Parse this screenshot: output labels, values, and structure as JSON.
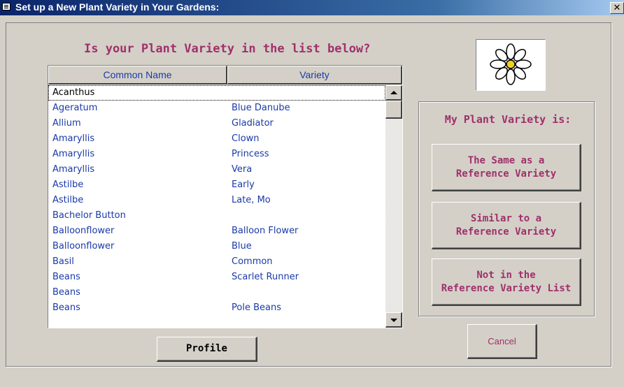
{
  "window": {
    "title": "Set up a New Plant Variety in Your Gardens:",
    "close_glyph": "✕"
  },
  "heading": "Is your Plant Variety in the list below?",
  "list": {
    "columns": [
      "Common Name",
      "Variety"
    ],
    "selected_index": 0,
    "rows": [
      {
        "name": "Acanthus",
        "variety": ""
      },
      {
        "name": "Ageratum",
        "variety": "Blue Danube"
      },
      {
        "name": "Allium",
        "variety": "Gladiator"
      },
      {
        "name": "Amaryllis",
        "variety": "Clown"
      },
      {
        "name": "Amaryllis",
        "variety": "Princess"
      },
      {
        "name": "Amaryllis",
        "variety": "Vera"
      },
      {
        "name": "Astilbe",
        "variety": "Early"
      },
      {
        "name": "Astilbe",
        "variety": "Late, Mo"
      },
      {
        "name": "Bachelor Button",
        "variety": ""
      },
      {
        "name": "Balloonflower",
        "variety": "Balloon Flower"
      },
      {
        "name": "Balloonflower",
        "variety": "Blue"
      },
      {
        "name": "Basil",
        "variety": "Common"
      },
      {
        "name": "Beans",
        "variety": "Scarlet Runner"
      },
      {
        "name": "Beans",
        "variety": ""
      },
      {
        "name": "Beans",
        "variety": "Pole Beans"
      }
    ]
  },
  "buttons": {
    "profile": "Profile",
    "cancel": "Cancel"
  },
  "panel": {
    "label": "My Plant Variety is:",
    "options": [
      "The Same as a\nReference Variety",
      "Similar to a\nReference Variety",
      "Not in the\nReference Variety List"
    ]
  },
  "icons": {
    "window_icon": "form-icon",
    "flower_image": "daisy-flower-icon"
  },
  "colors": {
    "title_bar": "#0a246a",
    "accent_text": "#a0306a",
    "list_text": "#1a3aa8",
    "face": "#d4d0c8"
  }
}
